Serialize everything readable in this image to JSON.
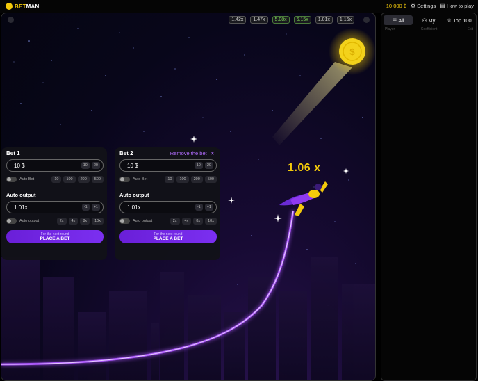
{
  "header": {
    "logo_bet": "BET",
    "logo_man": "MAN",
    "balance": "10 000 $",
    "settings_label": "Settings",
    "how_to_play_label": "How to play"
  },
  "history": [
    {
      "value": "1.42x",
      "green": false
    },
    {
      "value": "1.47x",
      "green": false
    },
    {
      "value": "5.08x",
      "green": true
    },
    {
      "value": "6.15x",
      "green": true
    },
    {
      "value": "1.01x",
      "green": false
    },
    {
      "value": "1.16x",
      "green": false
    }
  ],
  "game": {
    "coefficient": "1.06 x"
  },
  "bets": [
    {
      "title": "Bet 1",
      "remove_label": "",
      "amount": "10 $",
      "mini_buttons": [
        "10",
        "20"
      ],
      "auto_bet_label": "Auto Bet",
      "chips": [
        "10",
        "100",
        "200",
        "500"
      ],
      "auto_output_title": "Auto output",
      "auto_output_value": "1.01x",
      "step_buttons": [
        "-1",
        "+1"
      ],
      "auto_output_toggle_label": "Auto output",
      "multipliers": [
        "2x",
        "4x",
        "8x",
        "10x"
      ],
      "place_small": "For the next round",
      "place_big": "PLACE A BET"
    },
    {
      "title": "Bet 2",
      "remove_label": "Remove the bet",
      "remove_x": "✕",
      "amount": "10 $",
      "mini_buttons": [
        "10",
        "20"
      ],
      "auto_bet_label": "Auto Bet",
      "chips": [
        "10",
        "100",
        "200",
        "500"
      ],
      "auto_output_title": "Auto output",
      "auto_output_value": "1.01x",
      "step_buttons": [
        "-1",
        "+1"
      ],
      "auto_output_toggle_label": "Auto output",
      "multipliers": [
        "2x",
        "4x",
        "8x",
        "10x"
      ],
      "place_small": "For the next round",
      "place_big": "PLACE A BET"
    }
  ],
  "side": {
    "tabs": [
      {
        "label": "All",
        "icon": "list-icon",
        "active": true
      },
      {
        "label": "My",
        "icon": "user-icon",
        "active": false
      },
      {
        "label": "Top 100",
        "icon": "trophy-icon",
        "active": false
      }
    ],
    "columns": [
      "Player",
      "Coefficient",
      "Exit"
    ]
  },
  "colors": {
    "accent": "#f3c90b",
    "button": "#6a1fd8",
    "remove": "#b26cff",
    "curve": "#a855f7"
  }
}
